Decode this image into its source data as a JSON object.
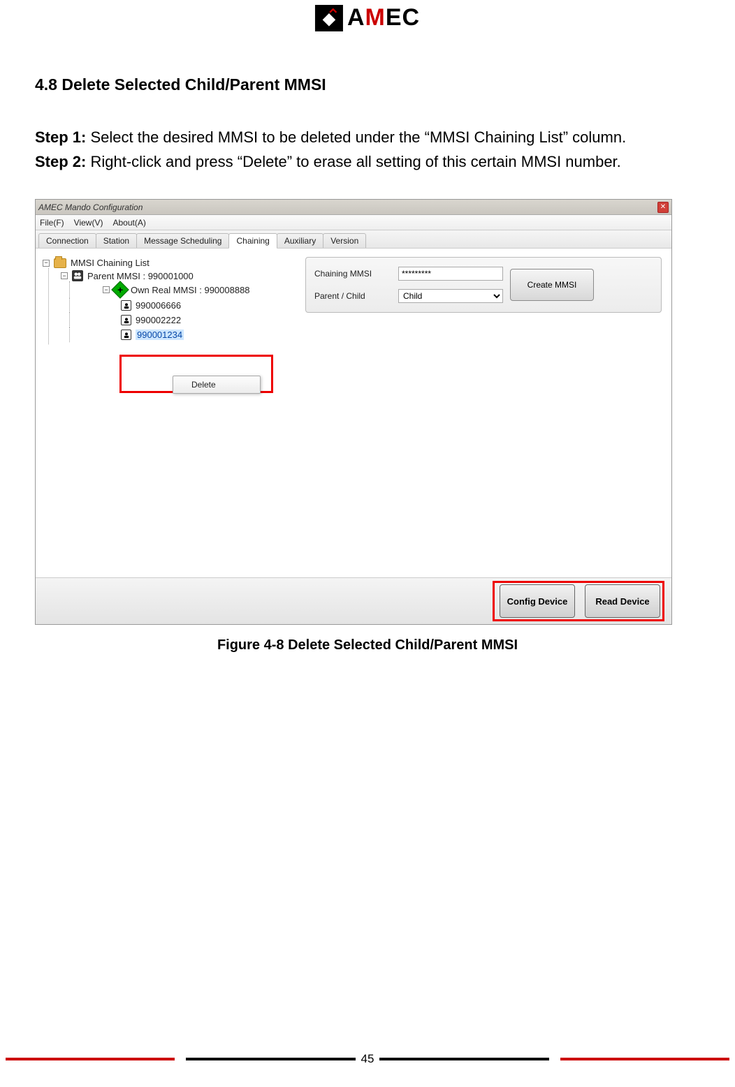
{
  "logo": {
    "text_pre": "A",
    "text_red": "M",
    "text_post": "EC"
  },
  "section_title": "4.8 Delete Selected Child/Parent MMSI",
  "steps": {
    "s1_label": "Step 1:",
    "s1_text": " Select the desired MMSI to be deleted under the “MMSI Chaining List” column.",
    "s2_label": "Step 2:",
    "s2_text": " Right-click and press “Delete” to erase all setting of this certain MMSI number."
  },
  "figure_caption": "Figure 4-8 Delete Selected Child/Parent MMSI",
  "page_number": "45",
  "window": {
    "title": "AMEC Mando Configuration",
    "menus": {
      "file": "File(F)",
      "view": "View(V)",
      "about": "About(A)"
    },
    "tabs": {
      "connection": "Connection",
      "station": "Station",
      "scheduling": "Message Scheduling",
      "chaining": "Chaining",
      "auxiliary": "Auxiliary",
      "version": "Version"
    },
    "form": {
      "chaining_mmsi_label": "Chaining MMSI",
      "chaining_mmsi_value": "*********",
      "parent_child_label": "Parent / Child",
      "parent_child_value": "Child",
      "create_btn": "Create MMSI"
    },
    "tree": {
      "root": "MMSI Chaining List",
      "parent": "Parent MMSI : 990001000",
      "own": "Own Real MMSI : 990008888",
      "c1": "990006666",
      "c2": "990002222",
      "c3": "990001234"
    },
    "context_menu": {
      "delete": "Delete"
    },
    "buttons": {
      "config": "Config Device",
      "read": "Read Device"
    }
  }
}
